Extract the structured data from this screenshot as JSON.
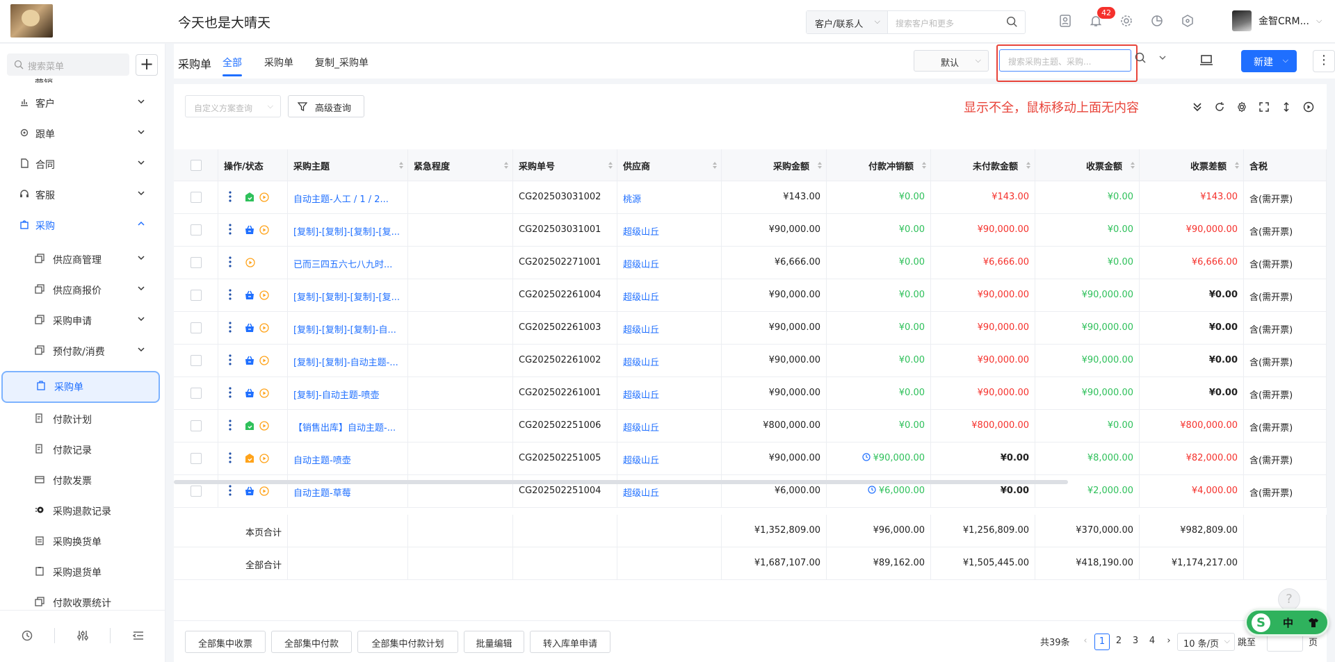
{
  "header": {
    "title": "今天也是大晴天",
    "search_scope": "客户/联系人",
    "search_placeholder": "搜索客户和更多",
    "notification_count": "42",
    "user_name": "金智CRM..."
  },
  "sidebar": {
    "search_placeholder": "搜索菜单",
    "cut_item": "营销",
    "items": [
      {
        "label": "客户"
      },
      {
        "label": "跟单"
      },
      {
        "label": "合同"
      },
      {
        "label": "客服"
      },
      {
        "label": "采购"
      }
    ],
    "sub_items": [
      {
        "label": "供应商管理"
      },
      {
        "label": "供应商报价"
      },
      {
        "label": "采购申请"
      },
      {
        "label": "预付款/消费"
      },
      {
        "label": "采购单"
      },
      {
        "label": "付款计划"
      },
      {
        "label": "付款记录"
      },
      {
        "label": "付款发票"
      },
      {
        "label": "采购退款记录"
      },
      {
        "label": "采购换货单"
      },
      {
        "label": "采购退货单"
      },
      {
        "label": "付款收票统计"
      }
    ]
  },
  "toolbar": {
    "page_title": "采购单",
    "tabs": [
      "全部",
      "采购单",
      "复制_采购单"
    ],
    "view_select": "默认",
    "search_placeholder": "搜索采购主题、采购...",
    "new_label": "新建",
    "filter_placeholder": "自定义方案查询",
    "advanced_query": "高级查询",
    "warning_note": "显示不全，鼠标移动上面无内容"
  },
  "table": {
    "headers": [
      "操作/状态",
      "采购主题",
      "紧急程度",
      "采购单号",
      "供应商",
      "采购金额",
      "付款冲销额",
      "未付款金额",
      "收票金额",
      "收票差额",
      "含税"
    ],
    "rows": [
      {
        "subject": "自动主题-人工 / 1 / 2...",
        "urgency": "",
        "no": "CG202503031002",
        "supplier": "桃源",
        "amount": "¥143.00",
        "paid": "¥0.00",
        "unpaid": "¥143.00",
        "invoiced": "¥0.00",
        "diff": "¥143.00",
        "tax": "含(需开票)"
      },
      {
        "subject": "[复制]-[复制]-[复制]-[复...",
        "urgency": "",
        "no": "CG202503031001",
        "supplier": "超级山丘",
        "amount": "¥90,000.00",
        "paid": "¥0.00",
        "unpaid": "¥90,000.00",
        "invoiced": "¥0.00",
        "diff": "¥90,000.00",
        "tax": "含(需开票)"
      },
      {
        "subject": "已而三四五六七八九时...",
        "urgency": "",
        "no": "CG202502271001",
        "supplier": "超级山丘",
        "amount": "¥6,666.00",
        "paid": "¥0.00",
        "unpaid": "¥6,666.00",
        "invoiced": "¥0.00",
        "diff": "¥6,666.00",
        "tax": "含(需开票)"
      },
      {
        "subject": "[复制]-[复制]-[复制]-[复...",
        "urgency": "",
        "no": "CG202502261004",
        "supplier": "超级山丘",
        "amount": "¥90,000.00",
        "paid": "¥0.00",
        "unpaid": "¥90,000.00",
        "invoiced": "¥90,000.00",
        "diff": "¥0.00",
        "tax": "含(需开票)"
      },
      {
        "subject": "[复制]-[复制]-[复制]-自...",
        "urgency": "",
        "no": "CG202502261003",
        "supplier": "超级山丘",
        "amount": "¥90,000.00",
        "paid": "¥0.00",
        "unpaid": "¥90,000.00",
        "invoiced": "¥90,000.00",
        "diff": "¥0.00",
        "tax": "含(需开票)"
      },
      {
        "subject": "[复制]-[复制]-自动主题-...",
        "urgency": "",
        "no": "CG202502261002",
        "supplier": "超级山丘",
        "amount": "¥90,000.00",
        "paid": "¥0.00",
        "unpaid": "¥90,000.00",
        "invoiced": "¥90,000.00",
        "diff": "¥0.00",
        "tax": "含(需开票)"
      },
      {
        "subject": "[复制]-自动主题-喷壶",
        "urgency": "",
        "no": "CG202502261001",
        "supplier": "超级山丘",
        "amount": "¥90,000.00",
        "paid": "¥0.00",
        "unpaid": "¥90,000.00",
        "invoiced": "¥90,000.00",
        "diff": "¥0.00",
        "tax": "含(需开票)"
      },
      {
        "subject": "【销售出库】自动主题-...",
        "urgency": "",
        "no": "CG202502251006",
        "supplier": "超级山丘",
        "amount": "¥800,000.00",
        "paid": "¥0.00",
        "unpaid": "¥800,000.00",
        "invoiced": "¥0.00",
        "diff": "¥800,000.00",
        "tax": "含(需开票)"
      },
      {
        "subject": "自动主题-喷壶",
        "urgency": "",
        "no": "CG202502251005",
        "supplier": "超级山丘",
        "amount": "¥90,000.00",
        "paid": "¥90,000.00",
        "unpaid": "¥0.00",
        "invoiced": "¥8,000.00",
        "diff": "¥82,000.00",
        "tax": "含(需开票)"
      },
      {
        "subject": "自动主题-草莓",
        "urgency": "",
        "no": "CG202502251004",
        "supplier": "超级山丘",
        "amount": "¥6,000.00",
        "paid": "¥6,000.00",
        "unpaid": "¥0.00",
        "invoiced": "¥2,000.00",
        "diff": "¥4,000.00",
        "tax": "含(需开票)"
      }
    ],
    "page_total": {
      "label": "本页合计",
      "amount": "¥1,352,809.00",
      "paid": "¥96,000.00",
      "unpaid": "¥1,256,809.00",
      "invoiced": "¥370,000.00",
      "diff": "¥982,809.00"
    },
    "all_total": {
      "label": "全部合计",
      "amount": "¥1,687,107.00",
      "paid": "¥89,162.00",
      "unpaid": "¥1,505,445.00",
      "invoiced": "¥418,190.00",
      "diff": "¥1,174,217.00"
    }
  },
  "bottom": {
    "buttons": [
      "全部集中收票",
      "全部集中付款",
      "全部集中付款计划",
      "批量编辑",
      "转入库单申请"
    ],
    "total_count": "共39条",
    "pages": [
      "1",
      "2",
      "3",
      "4"
    ],
    "page_size": "10 条/页",
    "jump_label": "跳至",
    "jump_tail": "页"
  },
  "widgets": {
    "help": "?",
    "float_s": "S",
    "float_text": "中"
  },
  "colors": {
    "accent": "#1f6fff",
    "green": "#2ec05a",
    "red": "#f5312c",
    "warn": "#e8443a"
  }
}
